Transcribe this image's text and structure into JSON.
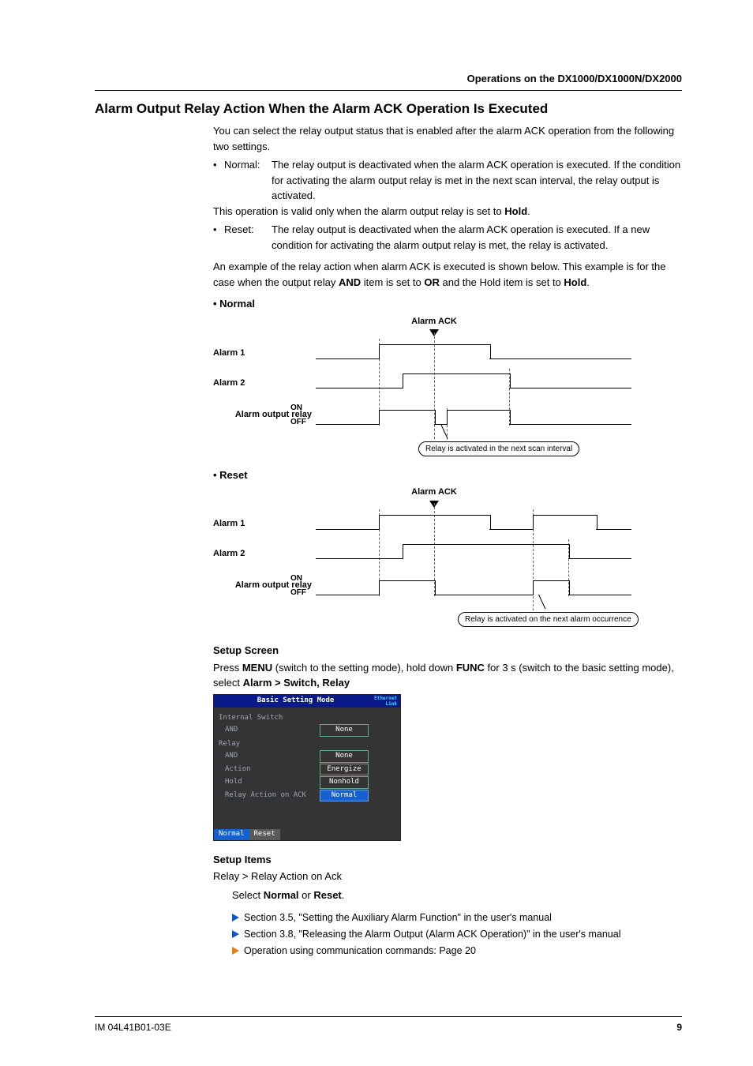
{
  "header": {
    "breadcrumb": "Operations on the DX1000/DX1000N/DX2000"
  },
  "title": "Alarm Output Relay Action When the Alarm ACK Operation Is Executed",
  "intro": "You can select the relay output status that is enabled after the alarm ACK operation from the following two settings.",
  "modes": {
    "normal": {
      "label": "Normal:",
      "body1": "The relay output is deactivated when the alarm ACK operation is executed. If the condition for activating the alarm output relay is met in the next scan interval, the relay output is activated.",
      "body2a": "This operation is valid only when the alarm output relay is set to ",
      "body2b": "Hold",
      "body2c": "."
    },
    "reset": {
      "label": "Reset:",
      "body1": "The relay output is deactivated when the alarm ACK operation is executed. If a new condition for activating the alarm output relay is met, the relay is activated."
    }
  },
  "example": {
    "p1a": "An example of the relay action when alarm ACK is executed is shown below. This example is for the case when the output relay ",
    "p1b": "AND",
    "p1c": " item is set to ",
    "p1d": "OR",
    "p1e": " and the Hold item is set to ",
    "p1f": "Hold",
    "p1g": "."
  },
  "diag": {
    "normal_head": "•  Normal",
    "reset_head": "•  Reset",
    "ack": "Alarm ACK",
    "a1": "Alarm 1",
    "a2": "Alarm 2",
    "out": "Alarm output relay",
    "on": "ON",
    "off": "OFF",
    "note_normal": "Relay is activated in the next scan interval",
    "note_reset": "Relay is activated on the next alarm occurrence"
  },
  "setup_screen": {
    "head": "Setup Screen",
    "p1a": "Press ",
    "p1b": "MENU",
    "p1c": " (switch to the setting mode), hold down ",
    "p1d": "FUNC",
    "p1e": " for 3 s (switch to the basic setting mode), select ",
    "p1f": "Alarm > Switch, Relay"
  },
  "shot": {
    "title": "Basic Setting Mode",
    "badge1": "Ethernet",
    "badge2": "Link",
    "sec1": "Internal Switch",
    "and_label": "AND",
    "and_val": "None",
    "sec2": "Relay",
    "action_label": "Action",
    "action_val": "Energize",
    "hold_label": "Hold",
    "hold_val": "Nonhold",
    "rack_label": "Relay Action on ACK",
    "rack_val": "Normal",
    "tab_normal": "Normal",
    "tab_reset": "Reset"
  },
  "setup_items": {
    "head": "Setup Items",
    "path": "Relay > Relay Action on Ack",
    "p1a": "Select ",
    "p1b": "Normal",
    "p1c": " or ",
    "p1d": "Reset",
    "p1e": "."
  },
  "refs": {
    "r1": "Section 3.5, \"Setting the Auxiliary Alarm Function\" in the user's manual",
    "r2": "Section 3.8, \"Releasing the Alarm Output (Alarm ACK Operation)\" in the user's manual",
    "r3": "Operation using communication commands: Page 20"
  },
  "footer": {
    "code": "IM 04L41B01-03E",
    "page": "9"
  }
}
